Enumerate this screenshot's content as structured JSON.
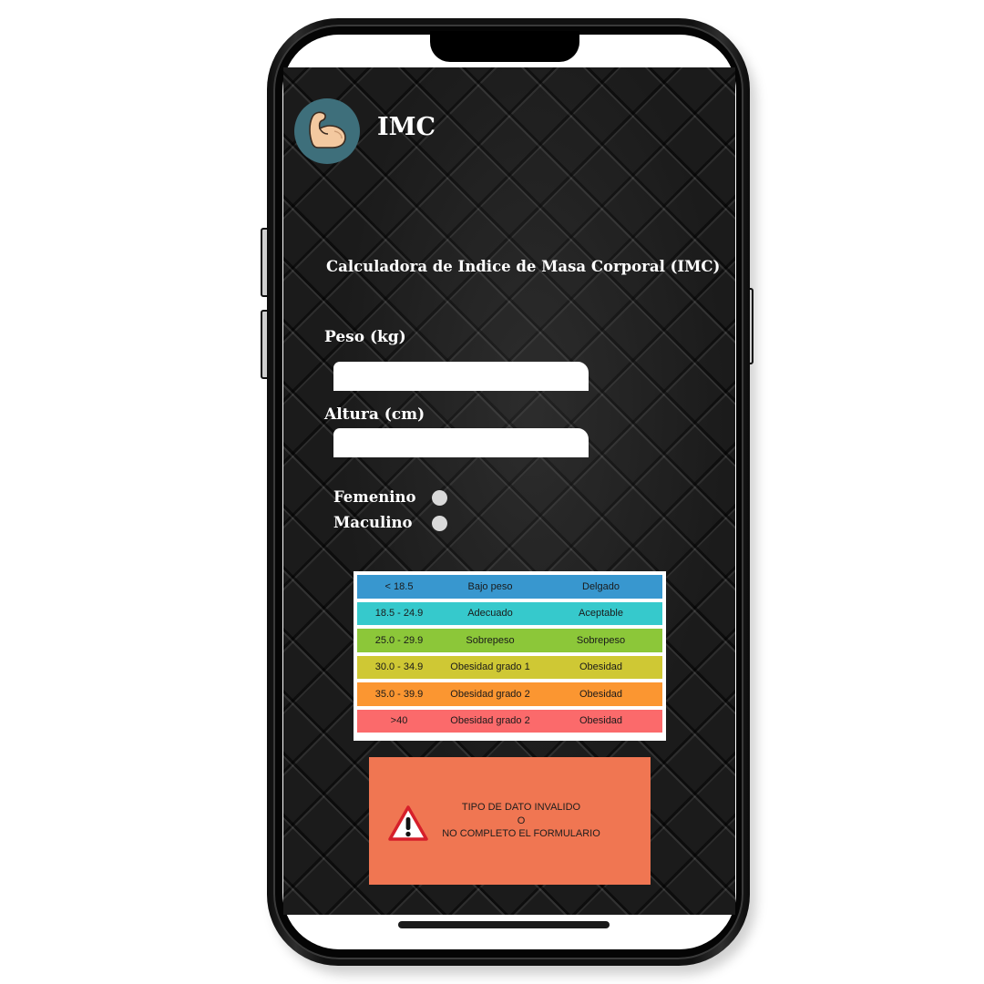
{
  "app": {
    "title": "IMC",
    "logo_icon": "flexed-biceps-icon",
    "logo_bg_color": "#3e6f7b"
  },
  "form": {
    "heading": "Calculadora de Indice de Masa Corporal (IMC)",
    "weight": {
      "label": "Peso (kg)",
      "value": "",
      "placeholder": ""
    },
    "height": {
      "label": "Altura (cm)",
      "value": "",
      "placeholder": ""
    },
    "gender_options": [
      {
        "label": "Femenino",
        "selected": false
      },
      {
        "label": "Maculino",
        "selected": false
      }
    ]
  },
  "bmi_table": {
    "rows": [
      {
        "range": "< 18.5",
        "category": "Bajo peso",
        "description": "Delgado",
        "color": "#3897cf"
      },
      {
        "range": "18.5 - 24.9",
        "category": "Adecuado",
        "description": "Aceptable",
        "color": "#36c9cc"
      },
      {
        "range": "25.0 - 29.9",
        "category": "Sobrepeso",
        "description": "Sobrepeso",
        "color": "#8cc739"
      },
      {
        "range": "30.0 - 34.9",
        "category": "Obesidad grado 1",
        "description": "Obesidad",
        "color": "#cfc834"
      },
      {
        "range": "35.0 - 39.9",
        "category": "Obesidad grado 2",
        "description": "Obesidad",
        "color": "#fb9631"
      },
      {
        "range": ">40",
        "category": "Obesidad grado 2",
        "description": "Obesidad",
        "color": "#fb6a6b"
      }
    ]
  },
  "error": {
    "icon": "warning-triangle-icon",
    "line1": "TIPO DE DATO INVALIDO",
    "line2": "O",
    "line3": "NO COMPLETO EL FORMULARIO",
    "bg_color": "#f07652"
  }
}
